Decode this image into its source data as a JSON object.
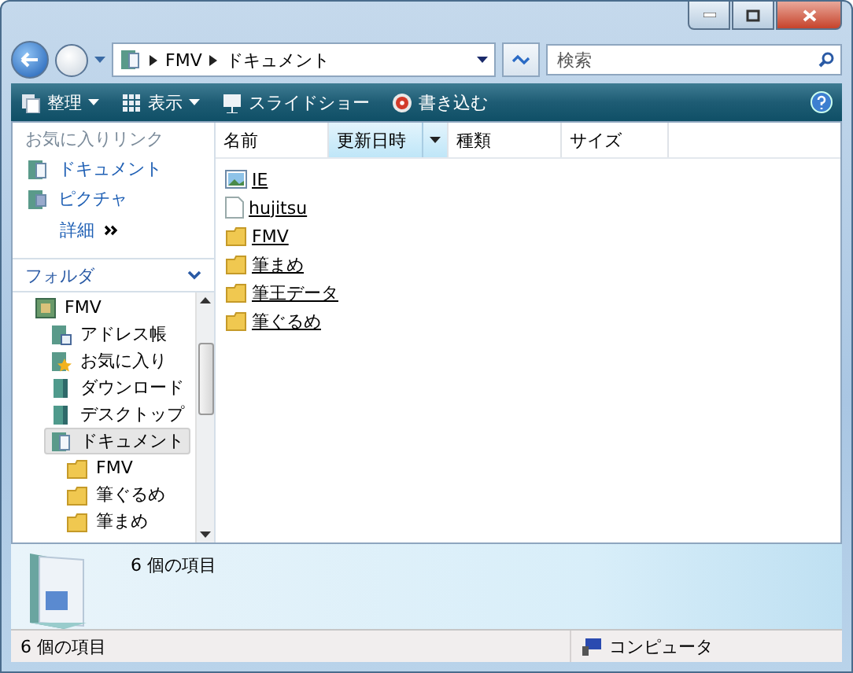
{
  "address": {
    "path": [
      "FMV",
      "ドキュメント"
    ]
  },
  "search": {
    "placeholder": "検索"
  },
  "toolbar": [
    {
      "label": "整理",
      "kind": "organize",
      "has_menu": true
    },
    {
      "label": "表示",
      "kind": "views",
      "has_menu": true
    },
    {
      "label": "スライドショー",
      "kind": "slideshow",
      "has_menu": false
    },
    {
      "label": "書き込む",
      "kind": "burn",
      "has_menu": false
    }
  ],
  "favorites": {
    "title": "お気に入りリンク",
    "items": [
      {
        "label": "ドキュメント",
        "kind": "documents"
      },
      {
        "label": "ピクチャ",
        "kind": "pictures"
      }
    ],
    "more": "詳細"
  },
  "folders": {
    "title": "フォルダ",
    "tree": [
      {
        "label": "FMV",
        "kind": "user",
        "selected": false,
        "children": [
          {
            "label": "アドレス帳",
            "kind": "contacts",
            "selected": false
          },
          {
            "label": "お気に入り",
            "kind": "favorites",
            "selected": false
          },
          {
            "label": "ダウンロード",
            "kind": "library",
            "selected": false
          },
          {
            "label": "デスクトップ",
            "kind": "library",
            "selected": false
          },
          {
            "label": "ドキュメント",
            "kind": "documents",
            "selected": true,
            "children": [
              {
                "label": "FMV",
                "kind": "folder",
                "selected": false
              },
              {
                "label": "筆ぐるめ",
                "kind": "folder",
                "selected": false
              },
              {
                "label": "筆まめ",
                "kind": "folder",
                "selected": false
              }
            ]
          }
        ]
      }
    ]
  },
  "columns": [
    {
      "label": "名前",
      "highlighted": false,
      "has_menu": false
    },
    {
      "label": "更新日時",
      "highlighted": true,
      "has_menu": true
    },
    {
      "label": "種類",
      "highlighted": false,
      "has_menu": false
    },
    {
      "label": "サイズ",
      "highlighted": false,
      "has_menu": false
    }
  ],
  "files": [
    {
      "name": "IE",
      "kind": "image"
    },
    {
      "name": "hujitsu",
      "kind": "text"
    },
    {
      "name": "FMV",
      "kind": "folder"
    },
    {
      "name": "筆まめ",
      "kind": "folder"
    },
    {
      "name": "筆王データ",
      "kind": "folder"
    },
    {
      "name": "筆ぐるめ",
      "kind": "folder"
    }
  ],
  "details": {
    "summary": "6 個の項目"
  },
  "status_bar": {
    "items": "6 個の項目",
    "location": "コンピュータ"
  }
}
